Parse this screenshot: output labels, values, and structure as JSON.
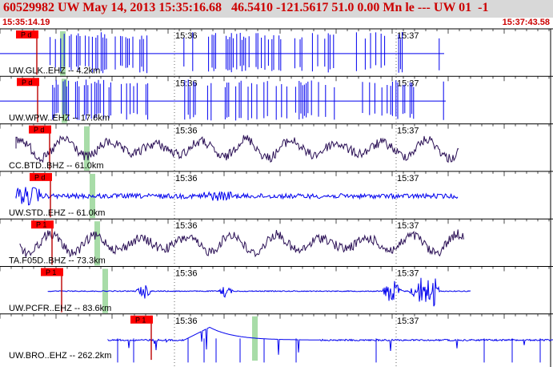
{
  "header": {
    "title": "60529982 UW May 14, 2013 15:35:16.68   46.5410 -121.5617 51.0 0.00 Mn le --- UW 01  -1",
    "start_time": "15:35:14.19",
    "end_time": "15:37:43.58"
  },
  "colors": {
    "background": "#ffffff",
    "header_bg": "#d8d8d8",
    "title": "#cc0000",
    "trace_blue": "#0000ee",
    "trace_dark": "#2a0f55",
    "pick_box": "#ff0000",
    "pick_line": "#bb0000",
    "window_band": "#a8dca8",
    "grid": "#000000"
  },
  "minute_labels": [
    "15:36",
    "15:37"
  ],
  "traces": [
    {
      "label": "UW.GLK..EHZ -- 4.2km",
      "pick": "P d",
      "style": "spiky",
      "color": "blue"
    },
    {
      "label": "UW.WPW..EHZ -- 17.6km",
      "pick": "P d",
      "style": "spiky",
      "color": "blue"
    },
    {
      "label": "CC.BTD..BHZ -- 61.0km",
      "pick": "P d",
      "style": "wave",
      "color": "dark"
    },
    {
      "label": "UW.STD..EHZ -- 61.0km",
      "pick": "P d",
      "style": "noise",
      "color": "blue"
    },
    {
      "label": "TA.F05D..BHZ -- 73.3km",
      "pick": "P 1",
      "style": "wave",
      "color": "dark"
    },
    {
      "label": "UW.PCFR..EHZ -- 83.6km",
      "pick": "P 1",
      "style": "bursts",
      "color": "blue"
    },
    {
      "label": "UW.BRO..EHZ -- 262.2km",
      "pick": "P 1",
      "style": "decay",
      "color": "blue"
    }
  ]
}
